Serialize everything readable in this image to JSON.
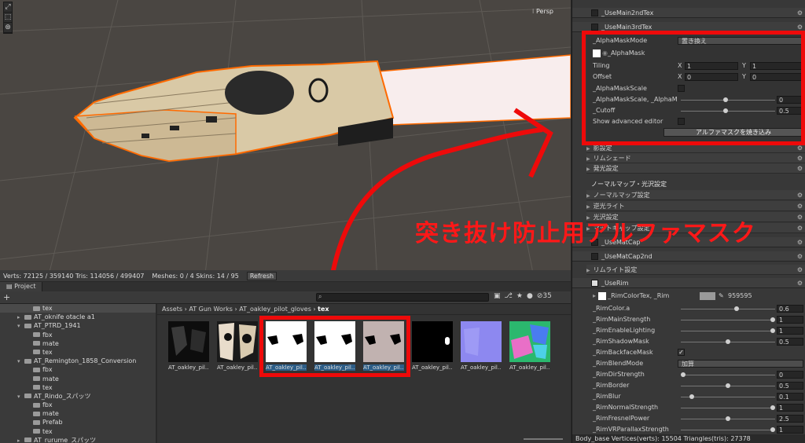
{
  "scene": {
    "persp_label": "⁝ Persp",
    "stats_text": "Verts: 72125 / 359140  Tris: 114056 / 499407",
    "meshes_text": "Meshes: 0 / 4  Skins: 14 / 95",
    "refresh_label": "Refresh",
    "tools": [
      "⤢",
      "⬚",
      "⊛"
    ]
  },
  "project": {
    "tab_label": "Project",
    "plus_label": "+",
    "toolbar_icons": [
      "▣",
      "⎇",
      "★",
      "●",
      "⊘35"
    ],
    "breadcrumb": [
      "Assets",
      "AT Gun Works",
      "AT_oakley_pilot_gloves",
      "tex"
    ],
    "tree": [
      {
        "label": "tex",
        "indent": 3,
        "selected": true,
        "arrow": ""
      },
      {
        "label": "AT_oknife otacle a1",
        "indent": 2,
        "selected": false,
        "arrow": "▸"
      },
      {
        "label": "AT_PTRD_1941",
        "indent": 2,
        "selected": false,
        "arrow": "▾"
      },
      {
        "label": "fbx",
        "indent": 3,
        "selected": false,
        "arrow": ""
      },
      {
        "label": "mate",
        "indent": 3,
        "selected": false,
        "arrow": ""
      },
      {
        "label": "tex",
        "indent": 3,
        "selected": false,
        "arrow": ""
      },
      {
        "label": "AT_Remington_1858_Conversion",
        "indent": 2,
        "selected": false,
        "arrow": "▾"
      },
      {
        "label": "fbx",
        "indent": 3,
        "selected": false,
        "arrow": ""
      },
      {
        "label": "mate",
        "indent": 3,
        "selected": false,
        "arrow": ""
      },
      {
        "label": "tex",
        "indent": 3,
        "selected": false,
        "arrow": ""
      },
      {
        "label": "AT_Rindo_スパッツ",
        "indent": 2,
        "selected": false,
        "arrow": "▾"
      },
      {
        "label": "fbx",
        "indent": 3,
        "selected": false,
        "arrow": ""
      },
      {
        "label": "mate",
        "indent": 3,
        "selected": false,
        "arrow": ""
      },
      {
        "label": "Prefab",
        "indent": 3,
        "selected": false,
        "arrow": ""
      },
      {
        "label": "tex",
        "indent": 3,
        "selected": false,
        "arrow": ""
      },
      {
        "label": "AT_rurume_スパッツ",
        "indent": 2,
        "selected": false,
        "arrow": "▸"
      }
    ],
    "thumbs": [
      {
        "label": "AT_oakley_pil...",
        "kind": "dark",
        "selected": false
      },
      {
        "label": "AT_oakley_pil...",
        "kind": "mono",
        "selected": false
      },
      {
        "label": "AT_oakley_pil...",
        "kind": "white",
        "selected": true
      },
      {
        "label": "AT_oakley_pil...",
        "kind": "white",
        "selected": true
      },
      {
        "label": "AT_oakley_pil...",
        "kind": "pink",
        "selected": true
      },
      {
        "label": "AT_oakley_pil...",
        "kind": "black",
        "selected": false
      },
      {
        "label": "AT_oakley_pil...",
        "kind": "normal",
        "selected": false
      },
      {
        "label": "AT_oakley_pil...",
        "kind": "mask",
        "selected": false
      }
    ]
  },
  "inspector": {
    "top_headers": [
      "_UseMain2ndTex",
      "_UseMain3rdTex"
    ],
    "alpha": {
      "mode_label": "_AlphaMaskMode",
      "mode_value": "置き換え",
      "mask_label": "_AlphaMask",
      "tiling_label": "Tiling",
      "tiling_x": "1",
      "tiling_y": "1",
      "offset_label": "Offset",
      "offset_x": "0",
      "offset_y": "0",
      "x_label": "X",
      "y_label": "Y",
      "scale_label": "_AlphaMaskScale",
      "scale2_label": "_AlphaMaskScale, _AlphaM",
      "scale2_value": "0",
      "cutoff_label": "_Cutoff",
      "cutoff_value": "0.5",
      "adv_label": "Show advanced editor",
      "bake_button": "アルファマスクを焼き込み"
    },
    "folds_a": [
      "影設定",
      "リムシェード",
      "発光設定"
    ],
    "section_normal": "ノーマルマップ・光沢設定",
    "folds_b": [
      "ノーマルマップ設定",
      "逆光ライト",
      "光沢設定",
      "マットキャップ設定"
    ],
    "matcap_headers": [
      "_UseMatCap",
      "_UseMatCap2nd"
    ],
    "rim_fold": "リムライト設定",
    "use_rim": "_UseRim",
    "rim_color_tex": "_RimColorTex, _Rim",
    "rim_color_hex": "959595",
    "rim_props": [
      {
        "label": "_RimColor.a",
        "value": "0.6",
        "knob": 0.6,
        "type": "slider"
      },
      {
        "label": "_RimMainStrength",
        "value": "1",
        "knob": 1.0,
        "type": "slider"
      },
      {
        "label": "_RimEnableLighting",
        "value": "1",
        "knob": 1.0,
        "type": "slider"
      },
      {
        "label": "_RimShadowMask",
        "value": "0.5",
        "knob": 0.5,
        "type": "slider"
      },
      {
        "label": "_RimBackfaceMask",
        "value": "✓",
        "knob": 0,
        "type": "check"
      },
      {
        "label": "_RimBlendMode",
        "value": "加算",
        "knob": 0,
        "type": "dropdown"
      },
      {
        "label": "_RimDirStrength",
        "value": "0",
        "knob": 0.0,
        "type": "slider"
      },
      {
        "label": "_RimBorder",
        "value": "0.5",
        "knob": 0.5,
        "type": "slider"
      },
      {
        "label": "_RimBlur",
        "value": "0.1",
        "knob": 0.1,
        "type": "slider"
      },
      {
        "label": "_RimNormalStrength",
        "value": "1",
        "knob": 1.0,
        "type": "slider"
      },
      {
        "label": "_RimFresnelPower",
        "value": "2.5",
        "knob": 0.5,
        "type": "slider"
      },
      {
        "label": "_RimVRParallaxStrength",
        "value": "1",
        "knob": 1.0,
        "type": "slider"
      }
    ],
    "status": "Body_base Vertices(verts): 15504  Triangles(tris): 27378"
  },
  "annotation": {
    "text": "突き抜け防止用アルファマスク",
    "color": "#ee0a0a"
  }
}
